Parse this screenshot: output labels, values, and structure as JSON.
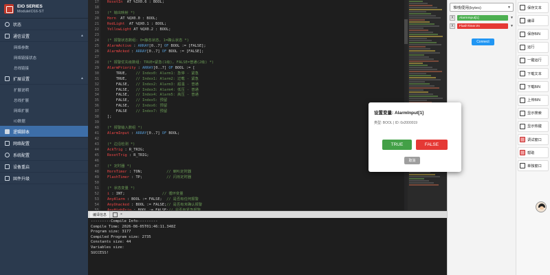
{
  "brand": {
    "title": "EIO SERIES",
    "subtitle": "ModuleIO16-ST"
  },
  "sidebar": {
    "items": [
      {
        "label": "状态",
        "icon": "monitor-icon"
      },
      {
        "label": "通信设置",
        "icon": "network-icon",
        "caret": "▲"
      },
      {
        "label": "网络参数",
        "sub": true
      },
      {
        "label": "网络链接状态",
        "sub": true
      },
      {
        "label": "总线链接",
        "sub": true
      },
      {
        "label": "扩展设置",
        "icon": "expand-icon",
        "caret": "▲"
      },
      {
        "label": "扩展说明",
        "sub": true
      },
      {
        "label": "总线扩展",
        "sub": true
      },
      {
        "label": "网络扩展",
        "sub": true
      },
      {
        "label": "IO数据",
        "sub": true
      },
      {
        "label": "逻辑脚本",
        "icon": "script-icon",
        "active": true
      },
      {
        "label": "网络配置",
        "icon": "globe-icon"
      },
      {
        "label": "系统配置",
        "icon": "gear-icon"
      },
      {
        "label": "设备重启",
        "icon": "restart-icon"
      },
      {
        "label": "固件升级",
        "icon": "upgrade-icon"
      }
    ]
  },
  "editor": {
    "line_start": 17,
    "lines": [
      [
        [
          "vr",
          "ResetIn"
        ],
        [
          "",
          "  AT %IX0.6 : BOOL;"
        ]
      ],
      [],
      [
        [
          "cm",
          "(* 输出映射 *)"
        ]
      ],
      [
        [
          "vr",
          "Horn"
        ],
        [
          "",
          "  AT %QX0.0 : BOOL;"
        ]
      ],
      [
        [
          "vr",
          "RedLight"
        ],
        [
          "",
          "  AT %QX0.1 : BOOL;"
        ]
      ],
      [
        [
          "vr",
          "YellowLight"
        ],
        [
          "",
          " AT %QX0.2 : BOOL;"
        ]
      ],
      [],
      [
        [
          "cm",
          "(* 报警状态数组: 0=静态状态, 1=确认状态 *)"
        ]
      ],
      [
        [
          "vr",
          "AlarmActive"
        ],
        [
          "",
          " : "
        ],
        [
          "kw",
          "ARRAY"
        ],
        [
          "",
          "[0..7] "
        ],
        [
          "kw",
          "OF"
        ],
        [
          "",
          " BOOL := [FALSE];"
        ]
      ],
      [
        [
          "vr",
          "AlarmAcked"
        ],
        [
          "",
          " : "
        ],
        [
          "kw",
          "ARRAY"
        ],
        [
          "",
          "[0..7] "
        ],
        [
          "kw",
          "OF"
        ],
        [
          "",
          " BOOL := [FALSE];"
        ]
      ],
      [],
      [
        [
          "cm",
          "(* 报警优先级数组: TRUE=紧急(1级), FALSE=普通(2级) *)"
        ]
      ],
      [
        [
          "vr",
          "AlarmPriority"
        ],
        [
          "",
          " : "
        ],
        [
          "kw",
          "ARRAY"
        ],
        [
          "",
          "[0..7] "
        ],
        [
          "kw",
          "OF"
        ],
        [
          "",
          " BOOL := ["
        ]
      ],
      [
        [
          "",
          "    TRUE,    "
        ],
        [
          "cm",
          "// Index0: Alarm1: 急停 - 紧急"
        ]
      ],
      [
        [
          "",
          "    TRUE,    "
        ],
        [
          "cm",
          "// Index1: Alarm2: 过载 - 紧急"
        ]
      ],
      [
        [
          "",
          "    FALSE,   "
        ],
        [
          "cm",
          "// Index2: Alarm3: 超温 - 普通"
        ]
      ],
      [
        [
          "",
          "    FALSE,   "
        ],
        [
          "cm",
          "// Index3: Alarm4: 低压 - 普通"
        ]
      ],
      [
        [
          "",
          "    FALSE,   "
        ],
        [
          "cm",
          "// Index4: Alarm5: 高压 - 普通"
        ]
      ],
      [
        [
          "",
          "    FALSE,   "
        ],
        [
          "cm",
          "// Index5: 预留"
        ]
      ],
      [
        [
          "",
          "    FALSE,   "
        ],
        [
          "cm",
          "// Index6: 预留"
        ]
      ],
      [
        [
          "",
          "    FALSE    "
        ],
        [
          "cm",
          "// Index7: 预留"
        ]
      ],
      [
        [
          "",
          "];"
        ]
      ],
      [],
      [
        [
          "cm",
          "(* 报警输入数组 *)"
        ]
      ],
      [
        [
          "vr",
          "AlarmInput"
        ],
        [
          "",
          " : "
        ],
        [
          "kw",
          "ARRAY"
        ],
        [
          "",
          "[0..7] "
        ],
        [
          "kw",
          "OF"
        ],
        [
          "",
          " BOOL;"
        ]
      ],
      [],
      [
        [
          "cm",
          "(* 边沿检测 *)"
        ]
      ],
      [
        [
          "vr",
          "AckTrig"
        ],
        [
          "",
          " : R_TRIG;"
        ]
      ],
      [
        [
          "vr",
          "ResetTrig"
        ],
        [
          "",
          " : R_TRIG;"
        ]
      ],
      [],
      [
        [
          "cm",
          "(* 定时器 *)"
        ]
      ],
      [
        [
          "vr",
          "HornTimer"
        ],
        [
          "",
          " : TON;           "
        ],
        [
          "cm",
          "// 喇叭定时器"
        ]
      ],
      [
        [
          "vr",
          "FlashTimer"
        ],
        [
          "",
          " : TP;           "
        ],
        [
          "cm",
          "// 闪烁定时器"
        ]
      ],
      [],
      [
        [
          "cm",
          "(* 状态变量 *)"
        ]
      ],
      [
        [
          "vr",
          "i"
        ],
        [
          "",
          " : INT;                 "
        ],
        [
          "cm",
          "// 循环变量"
        ]
      ],
      [
        [
          "vr",
          "AnyAlarm"
        ],
        [
          "",
          " : BOOL := FALSE;  "
        ],
        [
          "cm",
          "// 是否有任何报警"
        ]
      ],
      [
        [
          "vr",
          "AnyUnacked"
        ],
        [
          "",
          " : BOOL := FALSE;"
        ],
        [
          "cm",
          "// 是否有未确认报警"
        ]
      ],
      [
        [
          "vr",
          "AnyHighPrio"
        ],
        [
          "",
          " : BOOL := FALSE;"
        ],
        [
          "cm",
          "// 是否有紧急报警"
        ]
      ],
      [
        [
          "kw",
          "END_VAR"
        ]
      ]
    ]
  },
  "varpanel": {
    "select_label": "堆栈使用(bytes)",
    "var_rows": [
      {
        "remove": "X",
        "name": "AlarmInput[1]",
        "color": "#4caf50"
      },
      {
        "remove": "X",
        "name": "FlashTimer.IN",
        "color": "#e53935"
      }
    ],
    "connect_label": "Connect"
  },
  "toolbar": {
    "buttons": [
      {
        "label": "保存文本",
        "icon": "save-text-icon"
      },
      {
        "label": "编译",
        "icon": "compile-icon"
      },
      {
        "label": "保存BIN",
        "icon": "save-bin-icon"
      },
      {
        "label": "运行",
        "icon": "run-icon"
      },
      {
        "label": "一键运行",
        "icon": "one-click-run-icon"
      },
      {
        "label": "下载文本",
        "icon": "download-text-icon"
      },
      {
        "label": "下载BIN",
        "icon": "download-bin-icon"
      },
      {
        "label": "上传BIN",
        "icon": "upload-bin-icon"
      },
      {
        "label": "显示搜索",
        "icon": "search-icon"
      },
      {
        "label": "显示热键",
        "icon": "keyboard-icon"
      },
      {
        "label": "调试窗口",
        "icon": "debug-icon"
      },
      {
        "label": "帮助",
        "icon": "help-icon"
      },
      {
        "label": "单独窗口",
        "icon": "window-icon"
      }
    ]
  },
  "output": {
    "tab_label": "编译信息",
    "close_label": "×",
    "lines": [
      "---------Compile Info---------",
      "Compile Time: 2026-08-05T01:46:11.348Z",
      "Program size: 3177",
      "Compiled Program size: 2735",
      "Constants size: 44",
      "Variables size:",
      "SUCCESS!"
    ]
  },
  "modal": {
    "title": "设置变量: AlarmInput[1]",
    "info": "类型: BOOL | ID: 0x2000019",
    "true_label": "TRUE",
    "false_label": "FALSE",
    "cancel_label": "取消"
  }
}
